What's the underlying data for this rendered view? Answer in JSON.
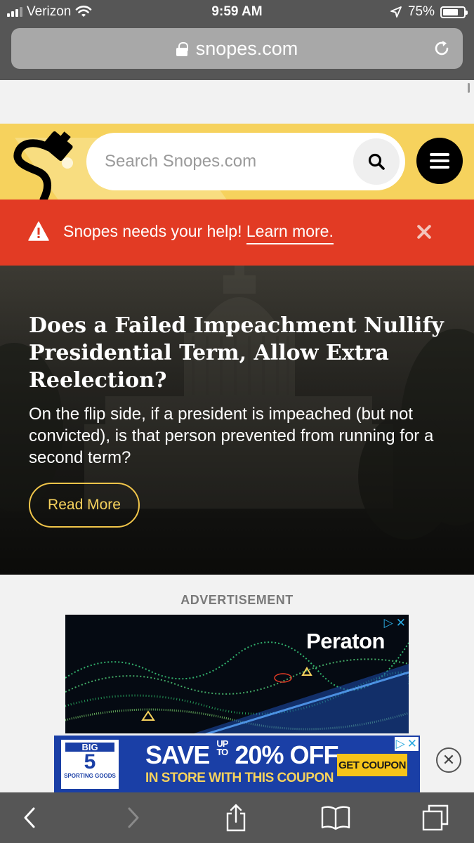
{
  "status_bar": {
    "carrier": "Verizon",
    "time": "9:59 AM",
    "battery": "75%",
    "battery_level": 0.75
  },
  "browser": {
    "url": "snopes.com"
  },
  "header": {
    "search_placeholder": "Search Snopes.com"
  },
  "alert": {
    "text": "Snopes needs your help!",
    "link": "Learn more",
    "period": "."
  },
  "hero": {
    "title": "Does a Failed Impeachment Nullify Presidential Term, Allow Extra Reelection?",
    "description": "On the flip side, if a president is impeached (but not convicted), is that person prevented from running for a second term?",
    "button": "Read More"
  },
  "ads": {
    "label": "ADVERTISEMENT",
    "peraton_brand": "Peraton",
    "big5": {
      "logo_top": "BIG",
      "logo_num": "5",
      "logo_bottom": "SPORTING GOODS",
      "save": "SAVE",
      "upto_1": "UP",
      "upto_2": "TO",
      "discount": "20% OFF",
      "instore": "IN STORE WITH THIS COUPON",
      "cta": "GET COUPON"
    }
  },
  "colors": {
    "header_yellow": "#f6d25d",
    "alert_red": "#e23b24",
    "button_gold": "#f0c54a",
    "chrome_gray": "#565656"
  },
  "icons": [
    "signal-icon",
    "wifi-icon",
    "location-icon",
    "battery-icon",
    "lock-icon",
    "reload-icon",
    "search-icon",
    "menu-icon",
    "warning-icon",
    "close-icon",
    "adchoices-icon",
    "back-icon",
    "forward-icon",
    "share-icon",
    "bookmarks-icon",
    "tabs-icon"
  ]
}
